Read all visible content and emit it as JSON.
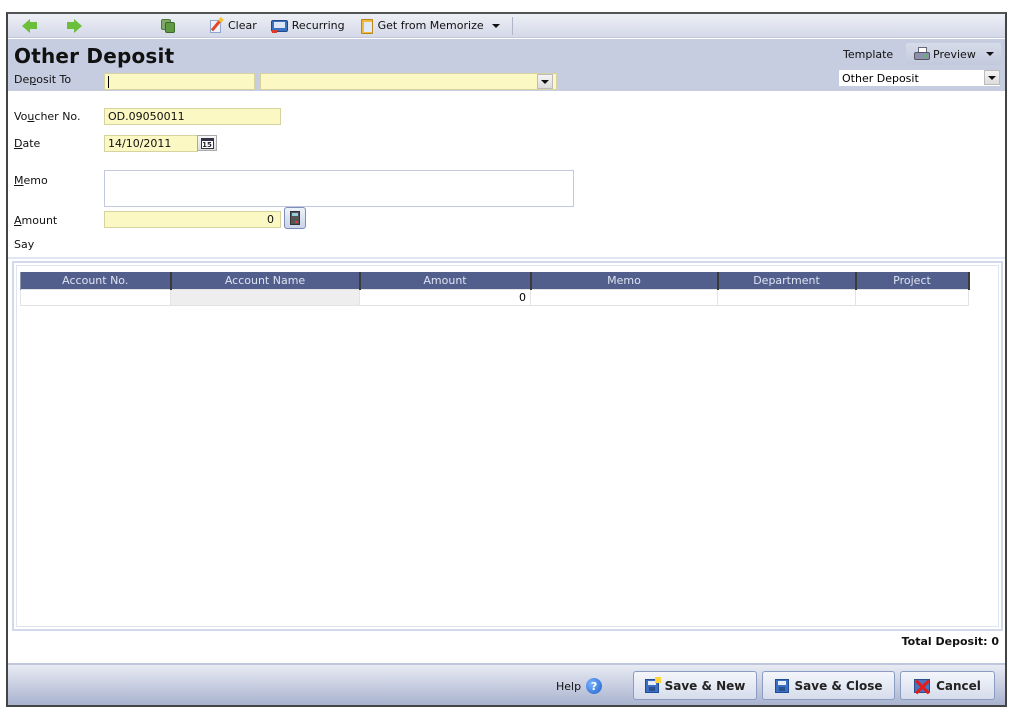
{
  "toolbar": {
    "back_icon": "arrow-left-icon",
    "forward_icon": "arrow-right-icon",
    "copy_icon": "copy-icon",
    "clear_label": "Clear",
    "recurring_label": "Recurring",
    "memorize_label": "Get from Memorize"
  },
  "header": {
    "title": "Other Deposit",
    "deposit_to_label": "Deposit To",
    "deposit_to_code": "",
    "deposit_to_name": "",
    "template_label": "Template",
    "preview_label": "Preview",
    "template_value": "Other Deposit"
  },
  "form": {
    "voucher_label": "Voucher No.",
    "voucher_value": "OD.09050011",
    "date_label": "Date",
    "date_value": "14/10/2011",
    "calendar_day": "15",
    "memo_label": "Memo",
    "memo_value": "",
    "amount_label": "Amount",
    "amount_value": "0",
    "say_label": "Say",
    "say_value": ""
  },
  "grid": {
    "columns": [
      "Account No.",
      "Account Name",
      "Amount",
      "Memo",
      "Department",
      "Project"
    ],
    "rows": [
      {
        "account_no": "",
        "account_name": "",
        "amount": "0",
        "memo": "",
        "department": "",
        "project": ""
      }
    ]
  },
  "summary": {
    "total_deposit": "Total Deposit: 0"
  },
  "footer": {
    "help_label": "Help",
    "save_new_label": "Save & New",
    "save_close_label": "Save & Close",
    "cancel_label": "Cancel"
  },
  "colors": {
    "header_bg": "#c6cde0",
    "field_bg": "#fbf8c4",
    "grid_header_bg": "#525f8c"
  }
}
